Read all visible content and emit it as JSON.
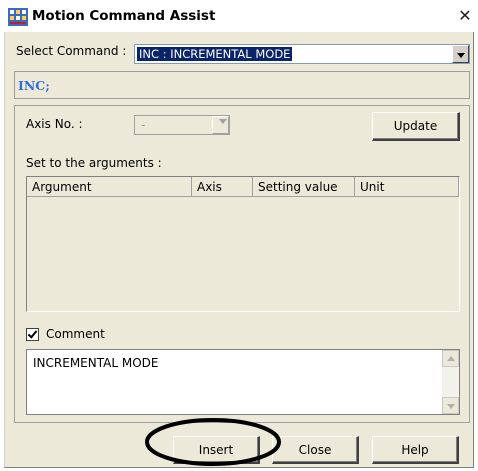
{
  "window": {
    "title": "Motion Command Assist",
    "close_glyph": "✕"
  },
  "select_command": {
    "label": "Select Command :",
    "value": "INC : INCREMENTAL MODE"
  },
  "preview_text": "INC;",
  "axis": {
    "label": "Axis No. :",
    "value": "-"
  },
  "update_label": "Update",
  "arguments": {
    "label": "Set to the arguments :",
    "columns": [
      "Argument",
      "Axis",
      "Setting value",
      "Unit"
    ]
  },
  "comment": {
    "label": "Comment",
    "checked": true,
    "text": "INCREMENTAL MODE"
  },
  "buttons": {
    "insert": "Insert",
    "close": "Close",
    "help": "Help"
  },
  "icons": [
    "app-icon",
    "close-icon",
    "dropdown-arrow-icon",
    "scroll-up-icon",
    "scroll-down-icon"
  ]
}
